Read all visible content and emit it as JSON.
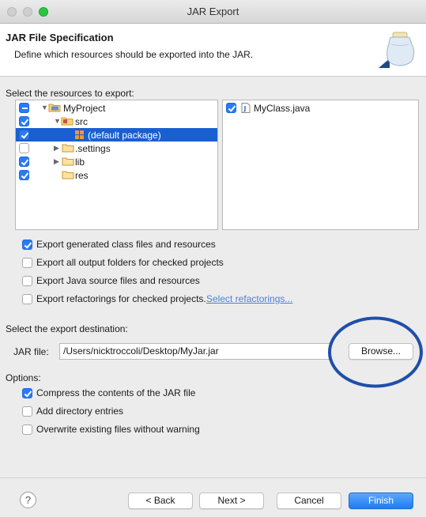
{
  "window": {
    "title": "JAR Export"
  },
  "header": {
    "title": "JAR File Specification",
    "description": "Define which resources should be exported into the JAR."
  },
  "resources": {
    "label": "Select the resources to export:",
    "tree": [
      {
        "label": "MyProject",
        "checked": "partial"
      },
      {
        "label": "src",
        "checked": true
      },
      {
        "label": "(default package)",
        "checked": true,
        "selected": true
      },
      {
        "label": ".settings",
        "checked": false
      },
      {
        "label": "lib",
        "checked": true
      },
      {
        "label": "res",
        "checked": true
      }
    ],
    "files": [
      {
        "label": "MyClass.java",
        "checked": true
      }
    ]
  },
  "export_options": [
    {
      "label": "Export generated class files and resources",
      "checked": true
    },
    {
      "label": "Export all output folders for checked projects",
      "checked": false
    },
    {
      "label": "Export Java source files and resources",
      "checked": false
    },
    {
      "label": "Export refactorings for checked projects.",
      "checked": false,
      "link": "Select refactorings..."
    }
  ],
  "destination": {
    "label": "Select the export destination:",
    "jar_label": "JAR file:",
    "jar_value": "/Users/nicktroccoli/Desktop/MyJar.jar",
    "browse_label": "Browse..."
  },
  "options": {
    "label": "Options:",
    "items": [
      {
        "label": "Compress the contents of the JAR file",
        "checked": true
      },
      {
        "label": "Add directory entries",
        "checked": false
      },
      {
        "label": "Overwrite existing files without warning",
        "checked": false
      }
    ]
  },
  "footer": {
    "help_label": "?",
    "back_label": "< Back",
    "next_label": "Next >",
    "cancel_label": "Cancel",
    "finish_label": "Finish"
  },
  "colors": {
    "accent": "#2a7bf5",
    "selection": "#1a5fd0",
    "annotation_circle": "#1f4fa8"
  }
}
